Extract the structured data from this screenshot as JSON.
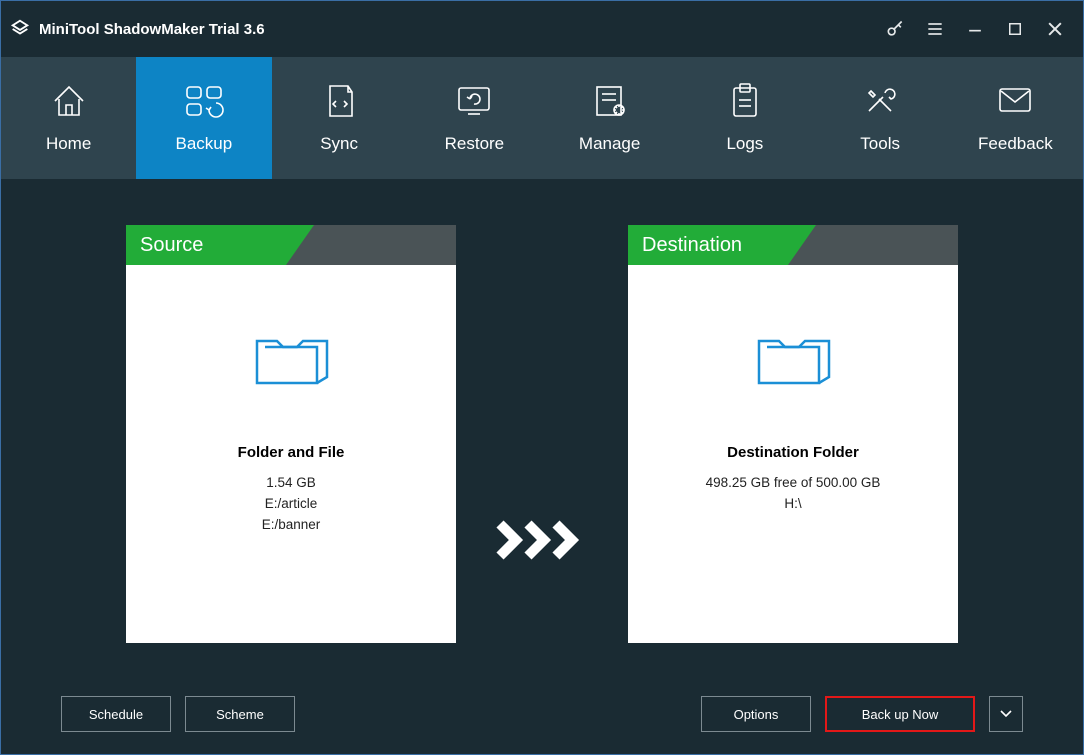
{
  "app": {
    "title": "MiniTool ShadowMaker Trial 3.6"
  },
  "nav": {
    "home": "Home",
    "backup": "Backup",
    "sync": "Sync",
    "restore": "Restore",
    "manage": "Manage",
    "logs": "Logs",
    "tools": "Tools",
    "feedback": "Feedback",
    "active": "backup"
  },
  "source": {
    "header": "Source",
    "title": "Folder and File",
    "size": "1.54 GB",
    "paths": [
      "E:/article",
      "E:/banner"
    ]
  },
  "destination": {
    "header": "Destination",
    "title": "Destination Folder",
    "free_text": "498.25 GB free of 500.00 GB",
    "path": "H:\\"
  },
  "buttons": {
    "schedule": "Schedule",
    "scheme": "Scheme",
    "options": "Options",
    "backup_now": "Back up Now"
  }
}
